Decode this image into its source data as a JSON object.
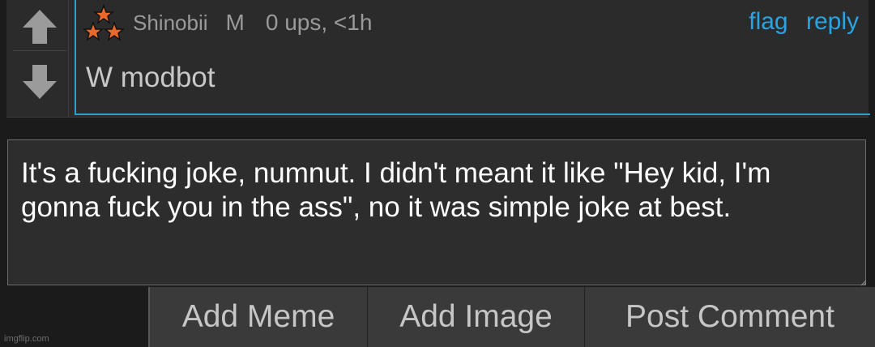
{
  "comment": {
    "username": "Shinobii",
    "gender": "M",
    "points": "0 ups, <1h",
    "flag_label": "flag",
    "reply_label": "reply",
    "text": "W modbot",
    "upvote_icon": "arrow-up-icon",
    "downvote_icon": "arrow-down-icon",
    "badge_icon": "stars-badge-icon"
  },
  "reply_box": {
    "value": "It's a fucking joke, numnut. I didn't meant it like \"Hey kid, I'm gonna fuck you in the ass\", no it was simple joke at best."
  },
  "buttons": {
    "add_meme": "Add Meme",
    "add_image": "Add Image",
    "post_comment": "Post Comment"
  },
  "watermark": "imgflip.com",
  "colors": {
    "accent": "#2a9fd6",
    "link": "#2aa4e0",
    "background": "#1b1b1b",
    "panel": "#2b2b2b",
    "star_orange": "#e8692a"
  }
}
